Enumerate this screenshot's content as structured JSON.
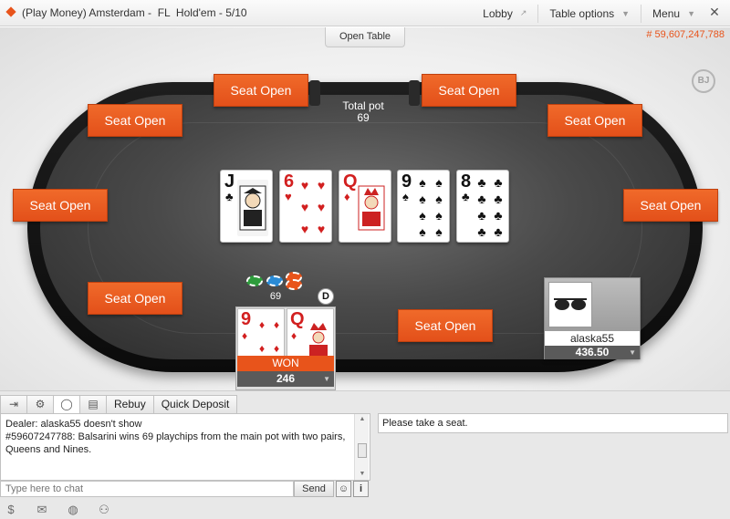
{
  "window": {
    "title": "(Play Money) Amsterdam -  FL  Hold'em - 5/10",
    "menus": [
      {
        "label": "Lobby",
        "icon": "external-arrow-icon"
      },
      {
        "label": "Table options",
        "icon": "chevron-down-icon"
      },
      {
        "label": "Menu",
        "icon": "chevron-down-icon"
      }
    ],
    "close_icon": "close-icon"
  },
  "table": {
    "open_table_label": "Open Table",
    "hand_number": "# 59,607,247,788",
    "logo_text": "BJ",
    "pot_label": "Total pot",
    "pot_amount": "69",
    "seat_open_label": "Seat Open",
    "board_cards": [
      {
        "rank": "J",
        "suit": "♣",
        "color": "black"
      },
      {
        "rank": "6",
        "suit": "♥",
        "color": "red"
      },
      {
        "rank": "Q",
        "suit": "♦",
        "color": "red"
      },
      {
        "rank": "9",
        "suit": "♠",
        "color": "black"
      },
      {
        "rank": "8",
        "suit": "♣",
        "color": "black"
      }
    ],
    "bet_chips_amount": "69",
    "dealer_button": "D",
    "chip_colors": [
      "#2e9c3c",
      "#2a8bd6",
      "#e8541b"
    ]
  },
  "hero": {
    "cards": [
      {
        "rank": "9",
        "suit": "♦",
        "color": "red"
      },
      {
        "rank": "Q",
        "suit": "♦",
        "color": "red"
      }
    ],
    "status": "WON",
    "stack": "246"
  },
  "player": {
    "name": "alaska55",
    "stack": "436.50",
    "avatar_icon": "sunglasses-icon"
  },
  "chat": {
    "tabs": [
      {
        "label": "",
        "icon": "exit-icon"
      },
      {
        "label": "",
        "icon": "gear-icon"
      },
      {
        "label": "",
        "icon": "chat-bubble-icon"
      },
      {
        "label": "",
        "icon": "notes-icon"
      },
      {
        "label": "Rebuy"
      },
      {
        "label": "Quick Deposit"
      }
    ],
    "log_lines": [
      "Dealer: alaska55 doesn't show",
      "#59607247788: Balsarini wins 69 playchips from the main pot with two pairs, Queens and Nines."
    ],
    "input_placeholder": "Type here to chat",
    "send_label": "Send",
    "emoji_label": "☺",
    "info_label": "i",
    "info_message": "Please take a seat."
  },
  "footer": {
    "icons": [
      "dollar-icon",
      "mail-icon",
      "globe-icon",
      "friends-icon"
    ]
  },
  "colors": {
    "accent": "#e8541b",
    "felt": "#4a4a4a",
    "rail": "#111111"
  }
}
